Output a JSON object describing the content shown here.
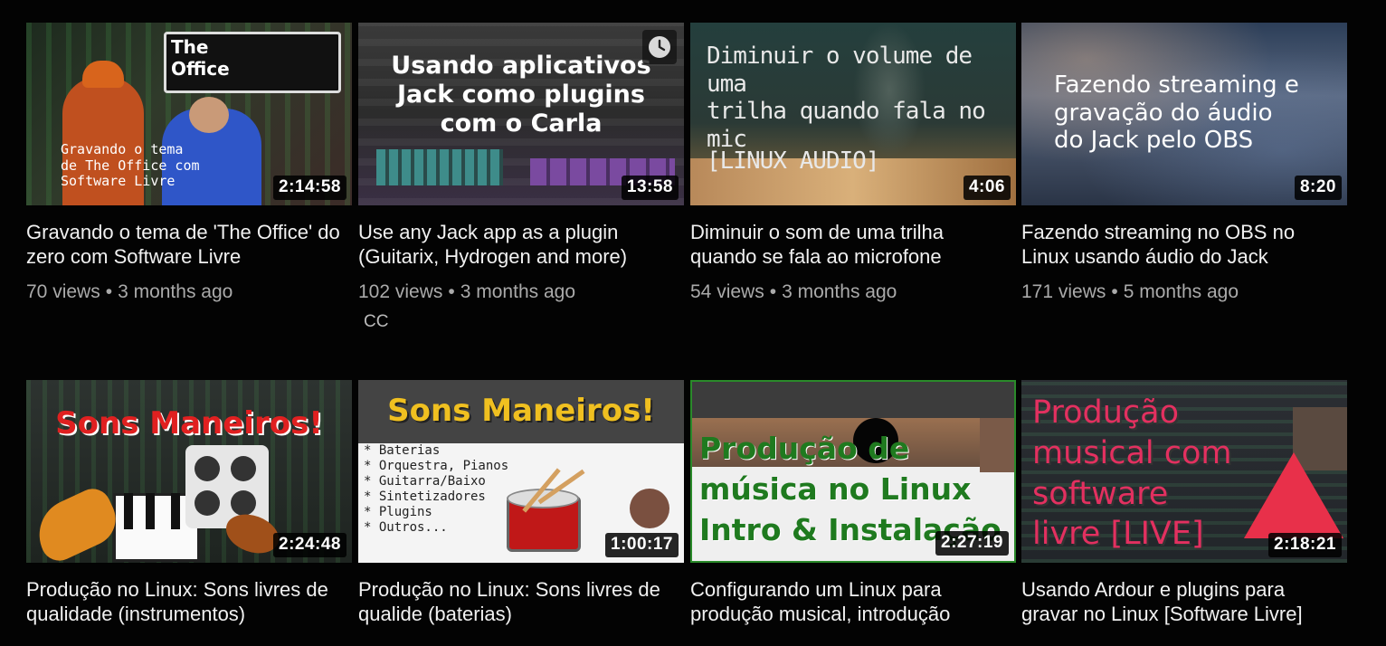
{
  "videos": [
    {
      "title": "Gravando o tema de 'The Office' do zero com Software Livre",
      "views": "70 views",
      "age": "3 months ago",
      "duration": "2:14:58",
      "thumb_overlay": "Gravando o tema\nde The Office com\nSoftware Livre",
      "thumb_badge": "The\nOffice"
    },
    {
      "title": "Use any Jack app as a plugin (Guitarix, Hydrogen and more)",
      "views": "102 views",
      "age": "3 months ago",
      "badge": "CC",
      "duration": "13:58",
      "thumb_overlay": "Usando aplicativos\nJack como plugins\ncom o Carla"
    },
    {
      "title": "Diminuir o som de uma trilha quando se fala ao microfone",
      "views": "54 views",
      "age": "3 months ago",
      "duration": "4:06",
      "thumb_overlay": "Diminuir o volume de uma\ntrilha quando fala no mic",
      "thumb_overlay2": "[LINUX AUDIO]"
    },
    {
      "title": "Fazendo streaming no OBS no Linux usando áudio do Jack",
      "views": "171 views",
      "age": "5 months ago",
      "duration": "8:20",
      "thumb_overlay": "Fazendo streaming e\ngravação do áudio\ndo Jack pelo OBS"
    },
    {
      "title": "Produção no Linux: Sons livres de qualidade (instrumentos)",
      "duration": "2:24:48",
      "thumb_overlay": "Sons Maneiros!"
    },
    {
      "title": "Produção no Linux: Sons livres de qualide (baterias)",
      "duration": "1:00:17",
      "thumb_overlay": "Sons Maneiros!",
      "thumb_list": "* Baterias\n* Orquestra, Pianos\n* Guitarra/Baixo\n* Sintetizadores\n* Plugins\n* Outros..."
    },
    {
      "title": "Configurando um Linux para produção musical, introdução",
      "duration": "2:27:19",
      "thumb_overlay": "Produção de\nmúsica no Linux\nIntro & Instalação"
    },
    {
      "title": "Usando Ardour e plugins para gravar no Linux [Software Livre]",
      "duration": "2:18:21",
      "thumb_overlay": "Produção\nmusical com\nsoftware\nlivre [LIVE]"
    }
  ],
  "icons": {
    "watch_later": "clock-icon"
  },
  "colors": {
    "background": "#030303",
    "meta_text": "#aaaaaa",
    "title_text": "#f1f1f1"
  }
}
